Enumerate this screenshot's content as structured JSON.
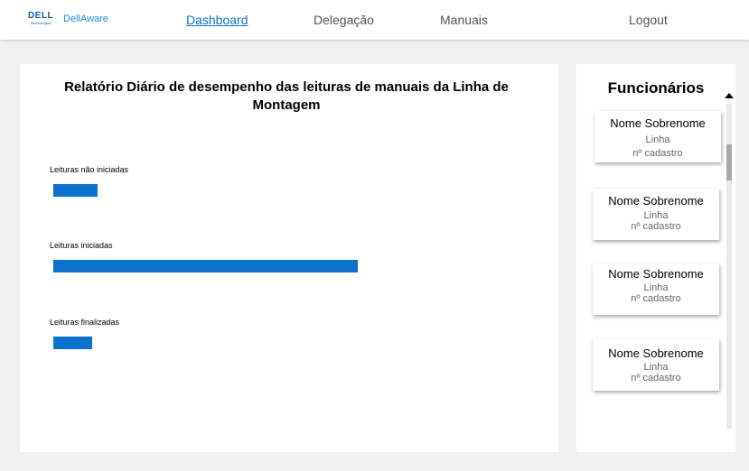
{
  "nav": {
    "logo_text": "DELL",
    "logo_sub": "Technologies",
    "brand": "DellAware",
    "links": [
      "Dashboard",
      "Delegação",
      "Manuais"
    ],
    "logout": "Logout"
  },
  "report": {
    "title": "Relatório Diário de desempenho das leituras de manuais da Linha de Montagem",
    "bar_color": "#0a72cc"
  },
  "chart_data": {
    "type": "bar",
    "orientation": "horizontal",
    "categories": [
      "Leituras não iniciadas",
      "Leituras iniciadas",
      "Leituras finalizadas"
    ],
    "values": [
      49,
      337,
      43
    ],
    "title": "Relatório Diário de desempenho das leituras de manuais da Linha de Montagem",
    "xlabel": "",
    "ylabel": "",
    "xlim": [
      0,
      530
    ],
    "grid": false
  },
  "employees": {
    "title": "Funcionários",
    "items": [
      {
        "name": "Nome Sobrenome",
        "line": "Linha",
        "reg": "nº cadastro"
      },
      {
        "name": "Nome Sobrenome",
        "line": "Linha",
        "reg": "nº cadastro"
      },
      {
        "name": "Nome Sobrenome",
        "line": "Linha",
        "reg": "nº cadastro"
      },
      {
        "name": "Nome Sobrenome",
        "line": "Linha",
        "reg": "nº cadastro"
      }
    ]
  }
}
